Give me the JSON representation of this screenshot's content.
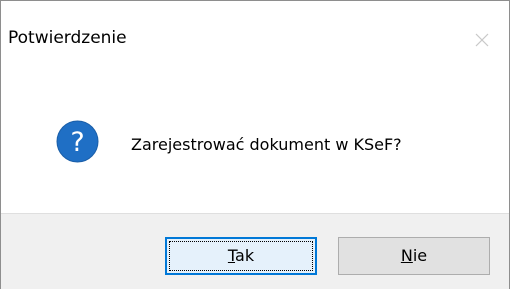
{
  "window": {
    "title": "Potwierdzenie"
  },
  "dialog": {
    "icon": "question-icon",
    "message": "Zarejestrować dokument w KSeF?"
  },
  "buttons": {
    "yes": {
      "mnemonic": "T",
      "rest": "ak",
      "default": true
    },
    "no": {
      "mnemonic": "N",
      "rest": "ie",
      "default": false
    }
  },
  "colors": {
    "icon_blue": "#1f6fc5",
    "focus_border": "#0078d7",
    "footer_bg": "#f0f0f0"
  }
}
